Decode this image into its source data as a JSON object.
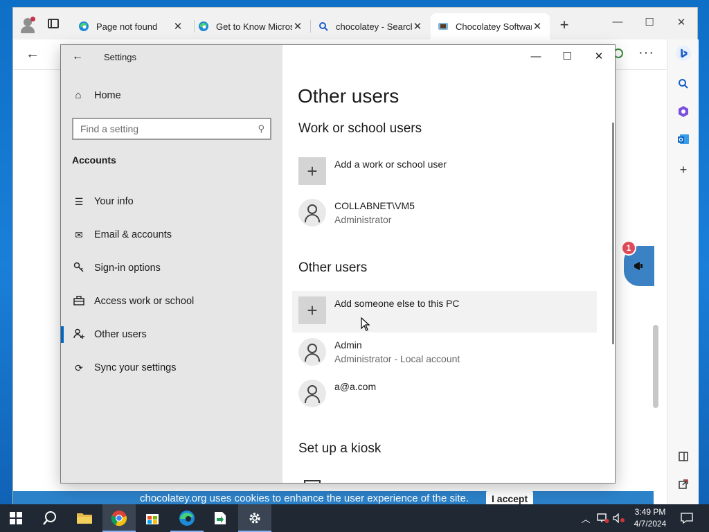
{
  "browser": {
    "tabs": [
      {
        "title": "Page not found",
        "icon": "edge-icon",
        "active": false
      },
      {
        "title": "Get to Know Microsoft",
        "icon": "edge-icon",
        "active": false
      },
      {
        "title": "chocolatey - Search",
        "icon": "search-icon",
        "active": false
      },
      {
        "title": "Chocolatey Software",
        "icon": "chocolatey-icon",
        "active": true
      }
    ],
    "new_tab_glyph": "+",
    "more_glyph": "···",
    "feedback_badge": "1",
    "cookie_banner": {
      "text": "chocolatey.org uses cookies to enhance the user experience of the site.",
      "button": "I accept"
    }
  },
  "settings": {
    "window_title": "Settings",
    "home_label": "Home",
    "search_placeholder": "Find a setting",
    "section": "Accounts",
    "nav": [
      {
        "label": "Your info",
        "icon": "person-list-icon",
        "selected": false
      },
      {
        "label": "Email & accounts",
        "icon": "mail-icon",
        "selected": false
      },
      {
        "label": "Sign-in options",
        "icon": "key-icon",
        "selected": false
      },
      {
        "label": "Access work or school",
        "icon": "briefcase-icon",
        "selected": false
      },
      {
        "label": "Other users",
        "icon": "add-person-icon",
        "selected": true
      },
      {
        "label": "Sync your settings",
        "icon": "sync-icon",
        "selected": false
      }
    ],
    "page_title": "Other users",
    "work_heading": "Work or school users",
    "add_work_label": "Add a work or school user",
    "work_users": [
      {
        "name": "COLLABNET\\VM5",
        "role": "Administrator"
      }
    ],
    "other_heading": "Other users",
    "add_other_label": "Add someone else to this PC",
    "other_users": [
      {
        "name": "Admin",
        "role": "Administrator - Local account"
      },
      {
        "name": "a@a.com",
        "role": ""
      }
    ],
    "kiosk_heading": "Set up a kiosk"
  },
  "taskbar": {
    "apps": [
      {
        "name": "search",
        "icon": "search-icon"
      },
      {
        "name": "file-explorer",
        "icon": "folder-icon"
      },
      {
        "name": "chrome",
        "icon": "chrome-icon"
      },
      {
        "name": "store",
        "icon": "store-icon"
      },
      {
        "name": "edge",
        "icon": "edge-icon"
      },
      {
        "name": "app",
        "icon": "green-app-icon"
      },
      {
        "name": "settings",
        "icon": "gear-icon"
      }
    ],
    "time": "3:49 PM",
    "date": "4/7/2024"
  },
  "colors": {
    "accent": "#0067c0",
    "taskbar": "#1f2833",
    "settings_nav_bg": "#e6e6e6",
    "cookie_bar": "#2c82c9",
    "badge": "#e24c5a"
  }
}
